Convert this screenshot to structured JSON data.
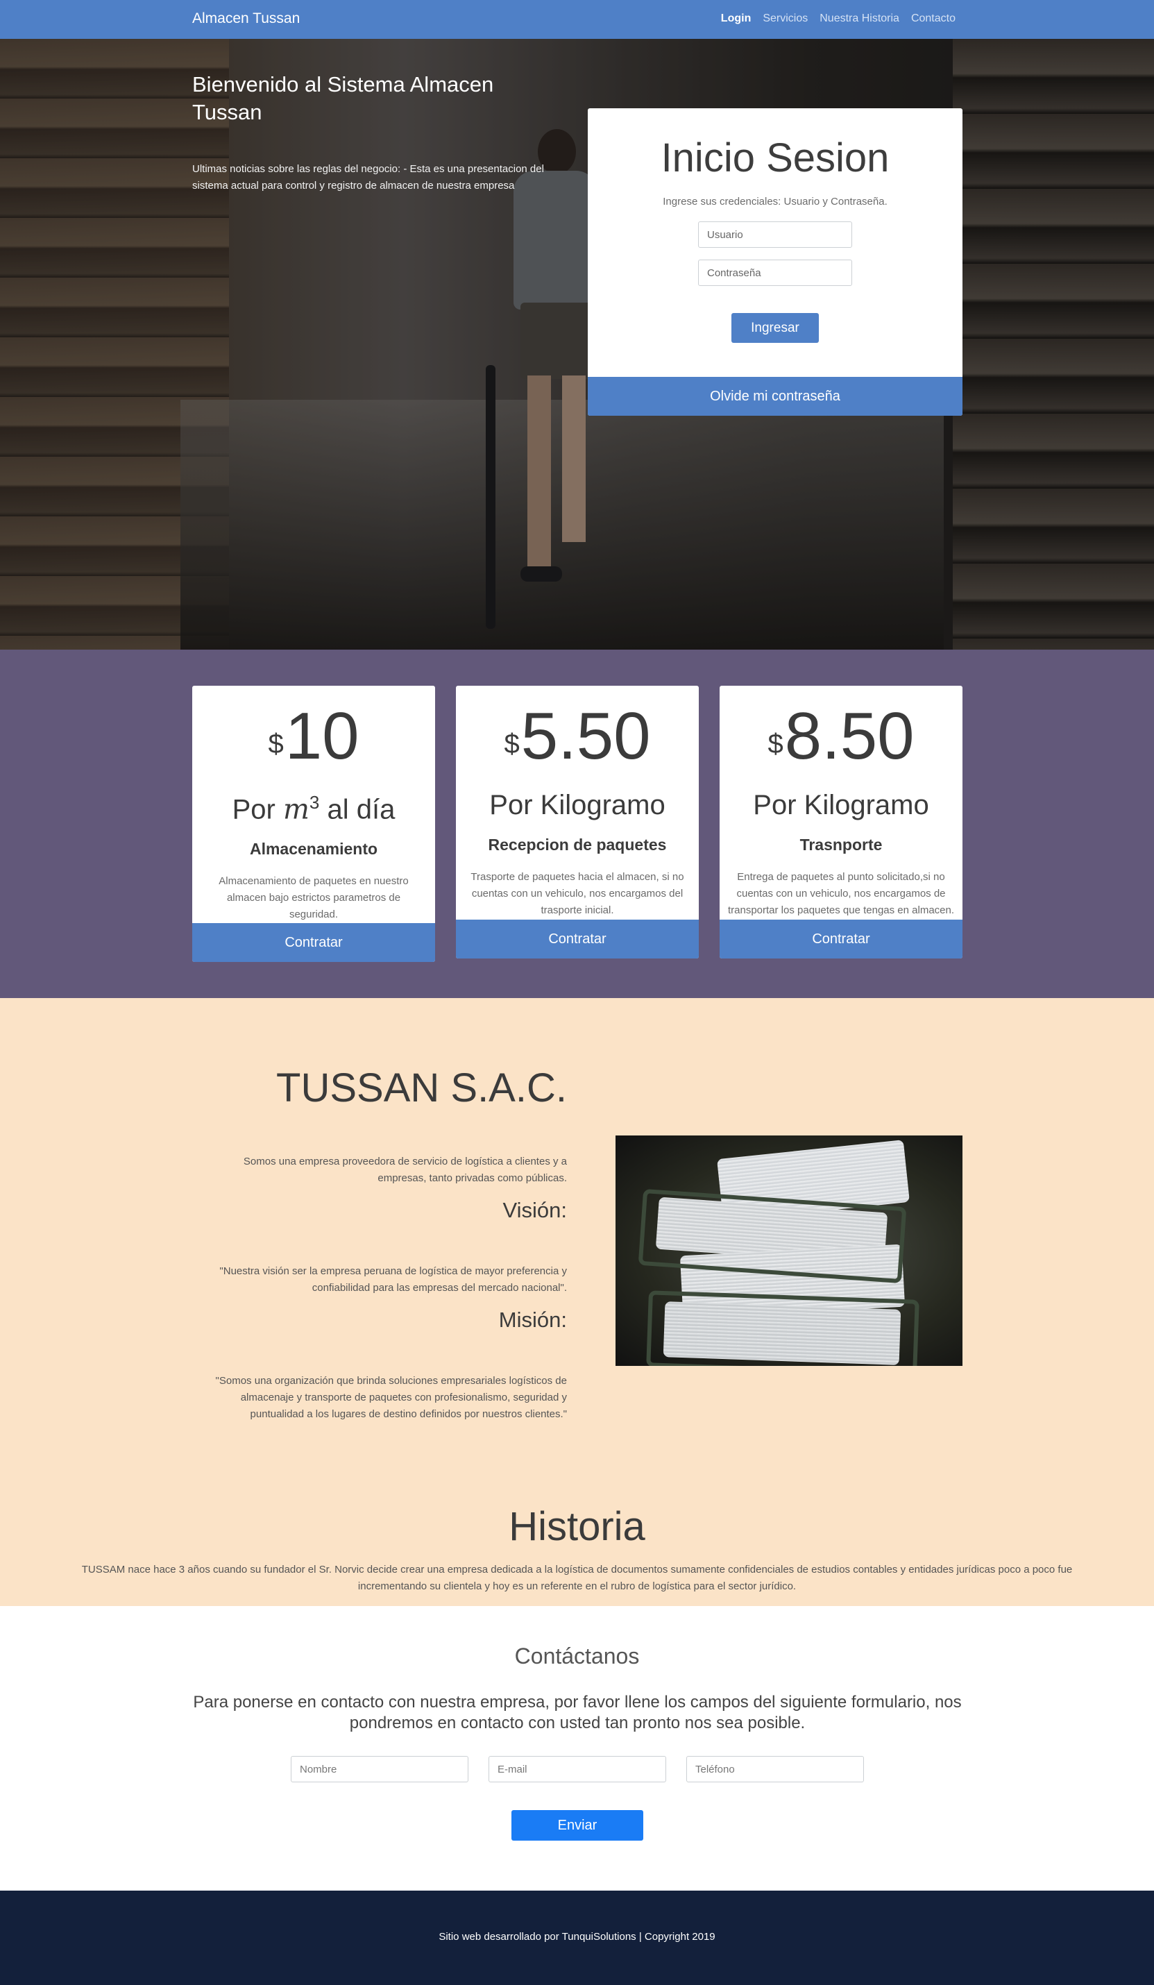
{
  "navbar": {
    "brand": "Almacen Tussan",
    "links": [
      {
        "label": "Login",
        "active": true
      },
      {
        "label": "Servicios",
        "active": false
      },
      {
        "label": "Nuestra Historia",
        "active": false
      },
      {
        "label": "Contacto",
        "active": false
      }
    ],
    "color": "#4f80c7"
  },
  "hero": {
    "title": "Bienvenido al Sistema Almacen Tussan",
    "news": "Ultimas noticias sobre las reglas del negocio: - Esta es una presentacion del sistema actual para control y registro de almacen de nuestra empresa"
  },
  "login": {
    "title": "Inicio Sesion",
    "subtitle": "Ingrese sus credenciales: Usuario y Contraseña.",
    "user_placeholder": "Usuario",
    "password_placeholder": "Contraseña",
    "submit_label": "Ingresar",
    "forgot_label": "Olvide mi contraseña"
  },
  "pricing": {
    "background": "#62587a",
    "currency": "$",
    "cards": [
      {
        "price": "10",
        "unit_prefix": "Por",
        "unit_var": "m",
        "unit_exp": "3",
        "unit_suffix": "al día",
        "name": "Almacenamiento",
        "description": "Almacenamiento de paquetes en nuestro almacen bajo estrictos parametros de seguridad.",
        "button_label": "Contratar"
      },
      {
        "price": "5.50",
        "unit": "Por Kilogramo",
        "name": "Recepcion de paquetes",
        "description": "Trasporte de paquetes hacia el almacen, si no cuentas con un vehiculo, nos encargamos del trasporte inicial.",
        "button_label": "Contratar"
      },
      {
        "price": "8.50",
        "unit": "Por Kilogramo",
        "name": "Trasnporte",
        "description": "Entrega de paquetes al punto solicitado,si no cuentas con un vehiculo, nos encargamos de transportar los paquetes que tengas en almacen.",
        "button_label": "Contratar"
      }
    ]
  },
  "about": {
    "background": "#fbe3c7",
    "title": "TUSSAN S.A.C.",
    "intro": "Somos una empresa proveedora de servicio de logística a clientes y a empresas, tanto privadas como públicas.",
    "vision_heading": "Visión:",
    "vision_text": "\"Nuestra visión ser la empresa peruana de logística de mayor preferencia y confiabilidad para las empresas del mercado nacional\".",
    "mission_heading": "Misión:",
    "mission_text": "\"Somos una organización que brinda soluciones empresariales logísticos de almacenaje y transporte de paquetes con profesionalismo, seguridad y puntualidad a los lugares de destino definidos por nuestros clientes.\""
  },
  "history": {
    "title": "Historia",
    "text": "TUSSAM nace hace 3 años cuando su fundador el Sr. Norvic decide crear una empresa dedicada a la logística de documentos sumamente confidenciales de estudios contables y entidades jurídicas poco a poco fue incrementando su clientela y hoy es un referente en el rubro de logística para el sector jurídico."
  },
  "contact": {
    "title": "Contáctanos",
    "text": "Para ponerse en contacto con nuestra empresa, por favor llene los campos del siguiente formulario, nos pondremos en contacto con usted tan pronto nos sea posible.",
    "name_placeholder": "Nombre",
    "email_placeholder": "E-mail",
    "phone_placeholder": "Teléfono",
    "submit_label": "Enviar",
    "button_color": "#1a7cf5"
  },
  "footer": {
    "text": "Sitio web desarrollado por TunquiSolutions | Copyright 2019",
    "background": "#13203b"
  }
}
